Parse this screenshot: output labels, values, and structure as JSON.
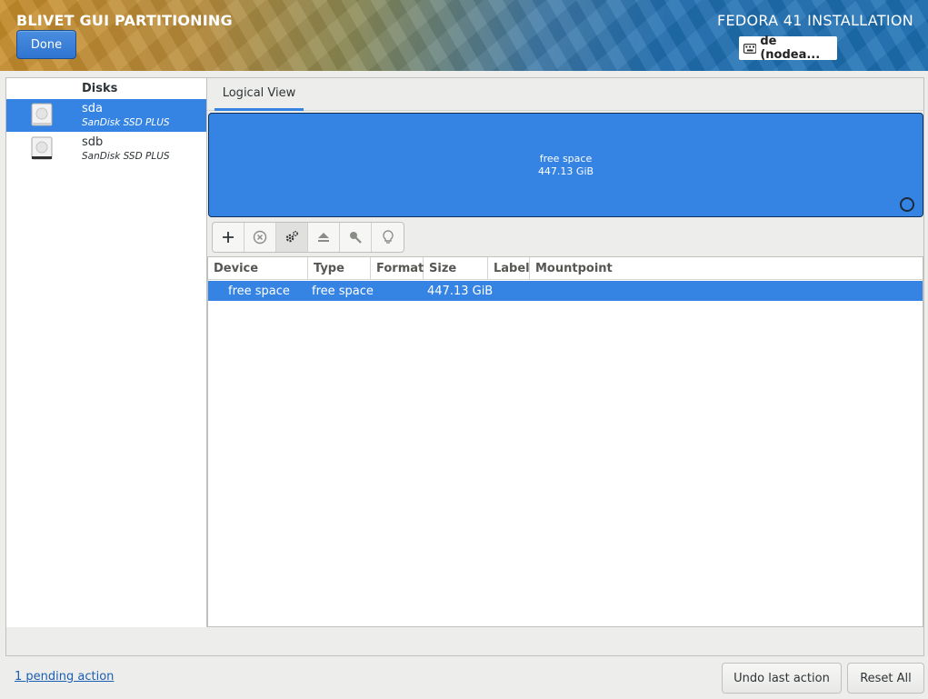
{
  "header": {
    "left_title": "BLIVET GUI PARTITIONING",
    "right_title": "FEDORA 41 INSTALLATION",
    "done_label": "Done",
    "keyboard_layout": "de (nodea...",
    "keyboard_icon": "keyboard-icon"
  },
  "sidebar": {
    "heading": "Disks",
    "disks": [
      {
        "name": "sda",
        "model": "SanDisk SSD PLUS",
        "icon": "disk-icon",
        "selected": true
      },
      {
        "name": "sdb",
        "model": "SanDisk SSD PLUS",
        "icon": "disk-icon",
        "selected": false
      }
    ]
  },
  "tabs": [
    {
      "label": "Logical View",
      "selected": true
    }
  ],
  "visualization": {
    "segment_label": "free space",
    "segment_size": "447.13 GiB"
  },
  "toolbar": {
    "icons": [
      "add-icon",
      "delete-icon",
      "settings-icon",
      "unmount-icon",
      "decrypt-key-icon",
      "info-bulb-icon"
    ]
  },
  "table": {
    "columns": [
      "Device",
      "Type",
      "Format",
      "Size",
      "Label",
      "Mountpoint"
    ],
    "rows": [
      {
        "device": "free space",
        "type": "free space",
        "format": "",
        "size": "447.13 GiB",
        "label": "",
        "mountpoint": "",
        "selected": true
      }
    ]
  },
  "footer": {
    "pending_link": "1 pending action",
    "undo_label": "Undo last action",
    "reset_label": "Reset All"
  },
  "colors": {
    "accent": "#3584e4",
    "header_blue": "#1b6fb3",
    "header_orange": "#c98e2a",
    "link": "#1a5fb4"
  }
}
